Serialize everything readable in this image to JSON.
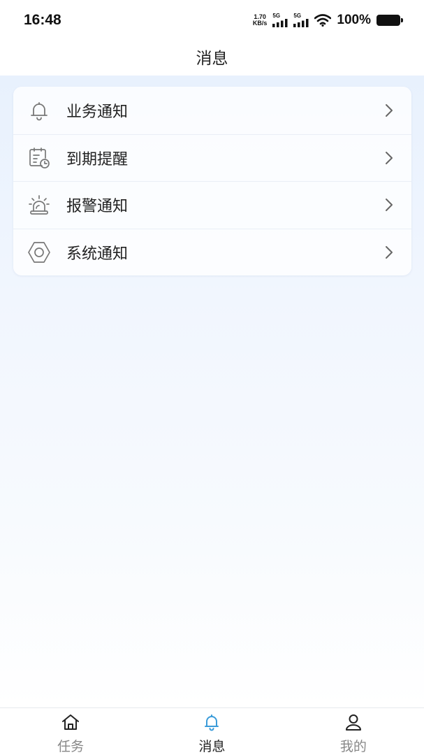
{
  "status_bar": {
    "time": "16:48",
    "net_speed_value": "1.70",
    "net_speed_unit": "KB/s",
    "signal1_tag": "5G",
    "signal2_tag": "5G",
    "battery": "100%"
  },
  "header": {
    "title": "消息"
  },
  "menu": {
    "items": [
      {
        "label": "业务通知",
        "icon": "bell-icon"
      },
      {
        "label": "到期提醒",
        "icon": "calendar-clock-icon"
      },
      {
        "label": "报警通知",
        "icon": "alarm-light-icon"
      },
      {
        "label": "系统通知",
        "icon": "gear-icon"
      }
    ]
  },
  "tab_bar": {
    "tabs": [
      {
        "label": "任务",
        "icon": "home-icon",
        "active": false
      },
      {
        "label": "消息",
        "icon": "bell-icon",
        "active": true
      },
      {
        "label": "我的",
        "icon": "user-icon",
        "active": false
      }
    ],
    "active_color": "#3a9bd9"
  }
}
